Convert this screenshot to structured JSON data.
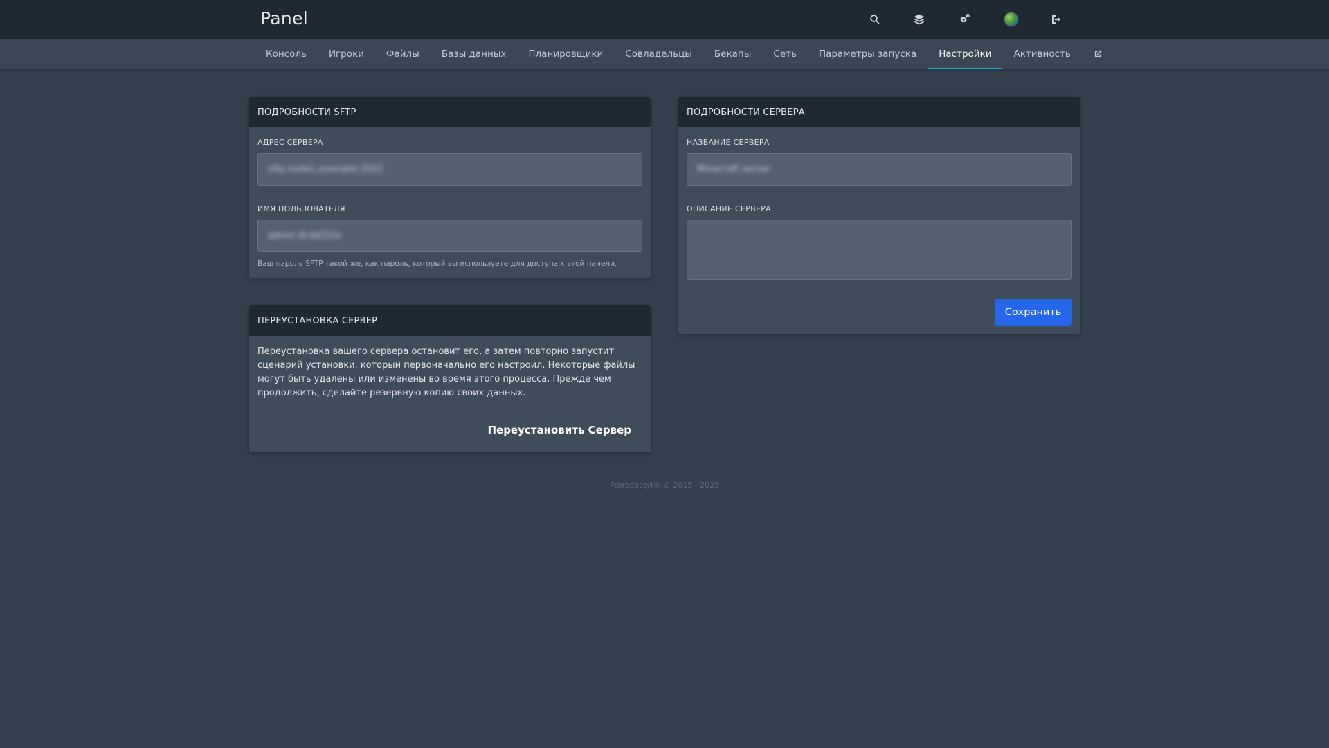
{
  "header": {
    "brand": "Panel",
    "icons": [
      "search-icon",
      "layers-icon",
      "cogs-icon",
      "avatar",
      "sign-out-icon"
    ]
  },
  "nav": {
    "tabs": [
      {
        "label": "Консоль"
      },
      {
        "label": "Игроки"
      },
      {
        "label": "Файлы"
      },
      {
        "label": "Базы данных"
      },
      {
        "label": "Планировщики"
      },
      {
        "label": "Совладельцы"
      },
      {
        "label": "Бекапы"
      },
      {
        "label": "Сеть"
      },
      {
        "label": "Параметры запуска"
      },
      {
        "label": "Настройки"
      },
      {
        "label": "Активность"
      }
    ],
    "active_tab": "Настройки",
    "external_icon": "external-link-icon"
  },
  "sftp": {
    "title": "ПОДРОБНОСТИ SFTP",
    "address_label": "АДРЕС СЕРВЕРА",
    "address_value": "sftp.node1.example:2022",
    "username_label": "ИМЯ ПОЛЬЗОВАТЕЛЯ",
    "username_value": "admin.8c4d1f2e",
    "hint": "Ваш пароль SFTP такой же, как пароль, который вы используете для доступа к этой панели."
  },
  "reinstall": {
    "title": "ПЕРЕУСТАНОВКА СЕРВЕР",
    "description": "Переустановка вашего сервера остановит его, а затем повторно запустит сценарий установки, который первоначально его настроил. Некоторые файлы могут быть удалены или изменены во время этого процесса. Прежде чем продолжить, сделайте резервную копию своих данных.",
    "button_label": "Переустановить Сервер"
  },
  "server": {
    "title": "ПОДРОБНОСТИ СЕРВЕРА",
    "name_label": "НАЗВАНИЕ СЕРВЕРА",
    "name_value": "Minecraft server",
    "description_label": "ОПИСАНИЕ СЕРВЕРА",
    "description_value": "",
    "save_label": "Сохранить"
  },
  "footer": {
    "text": "Pterodactyl® © 2015 - 2025"
  },
  "colors": {
    "background": "#33404d",
    "topbar": "#1f2933",
    "subnav": "#3b4754",
    "card": "#3f4c5a",
    "accent_tab": "#22a5c7",
    "primary_button": "#2567e8"
  }
}
